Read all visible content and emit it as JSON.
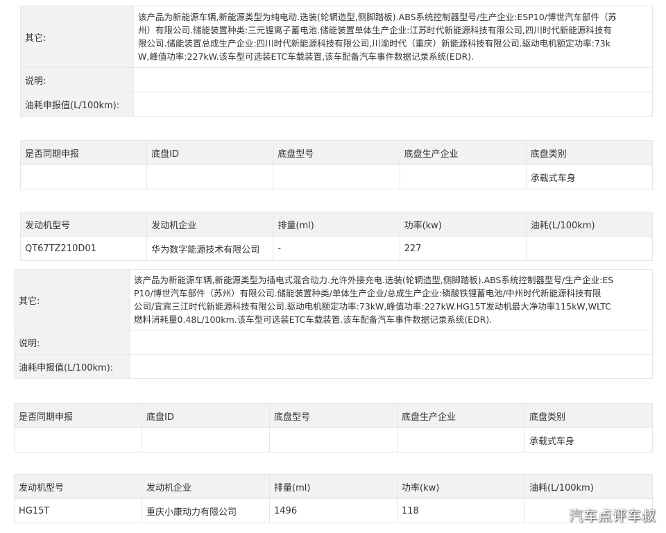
{
  "section1": {
    "other": {
      "label": "其它:",
      "lines": [
        "该产品为新能源车辆,新能源类型为纯电动.选装(轮辋造型,侧脚踏板).ABS系统控制器型号/生产企业:ESP10/博世汽车部件（苏",
        "州）有限公司.储能装置种类:三元锂离子蓄电池.储能装置单体生产企业:江苏时代新能源科技有限公司,四川时代新能源科技有",
        "限公司.储能装置总成生产企业:四川时代新能源科技有限公司,川渝时代（重庆）新能源科技有限公司.驱动电机额定功率:73k",
        "W,峰值功率:227kW.该车型可选装ETC车载装置,该车配备汽车事件数据记录系统(EDR)."
      ]
    },
    "note_label": "说明:",
    "fuel_label": "油耗申报值(L/100km):",
    "chassis": {
      "headers": [
        "是否同期申报",
        "底盘ID",
        "底盘型号",
        "底盘生产企业",
        "底盘类别"
      ],
      "row": [
        "",
        "",
        "",
        "",
        "承载式车身"
      ]
    },
    "engine": {
      "headers": [
        "发动机型号",
        "发动机企业",
        "排量(ml)",
        "功率(kw)",
        "油耗(L/100km)"
      ],
      "row": [
        "QT67TZ210D01",
        "华为数字能源技术有限公司",
        "-",
        "227",
        ""
      ]
    }
  },
  "section2": {
    "other": {
      "label": "其它:",
      "lines": [
        "该产品为新能源车辆,新能源类型为插电式混合动力.允许外接充电.选装(轮辋造型,侧脚踏板).ABS系统控制器型号/生产企业:ES",
        "P10/博世汽车部件（苏州）有限公司.储能装置种类/单体生产企业/总成生产企业:磷酸铁锂蓄电池/中州时代新能源科技有限",
        "公司/宜宾三江时代新能源科技有限公司.驱动电机额定功率:73kW,峰值功率:227kW.HG15T发动机最大净功率115kW,WLTC",
        "燃料消耗量0.48L/100km.该车型可选装ETC车载装置.该车配备汽车事件数据记录系统(EDR)."
      ]
    },
    "note_label": "说明:",
    "fuel_label": "油耗申报值(L/100km):",
    "chassis": {
      "headers": [
        "是否同期申报",
        "底盘ID",
        "底盘型号",
        "底盘生产企业",
        "底盘类别"
      ],
      "row": [
        "",
        "",
        "",
        "",
        "承载式车身"
      ]
    },
    "engine": {
      "headers": [
        "发动机型号",
        "发动机企业",
        "排量(ml)",
        "功率(kw)",
        "油耗(L/100km)"
      ],
      "row": [
        "HG15T",
        "重庆小康动力有限公司",
        "1496",
        "118",
        ""
      ]
    }
  },
  "watermark": "汽车点评车叔"
}
